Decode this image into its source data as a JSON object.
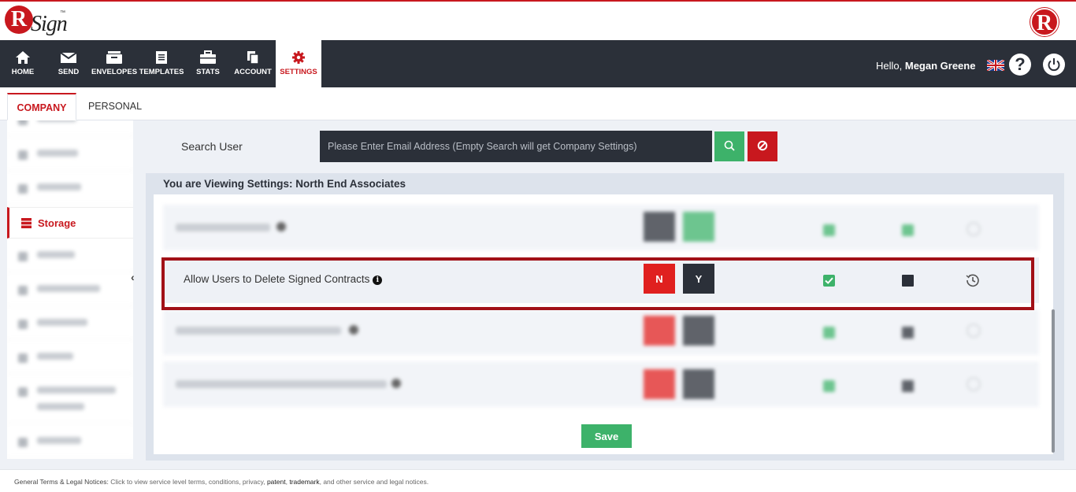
{
  "brand": {
    "logo_letter": "R",
    "logo_word": "Sign",
    "logo_tm": "™",
    "badge_letter": "R",
    "colors": {
      "accent": "#c8181e",
      "navbar": "#2b3039",
      "success": "#3db26a"
    }
  },
  "nav": {
    "items": [
      {
        "label": "HOME",
        "icon": "home-icon"
      },
      {
        "label": "SEND",
        "icon": "envelope-icon"
      },
      {
        "label": "ENVELOPES",
        "icon": "inbox-icon"
      },
      {
        "label": "TEMPLATES",
        "icon": "document-icon"
      },
      {
        "label": "STATS",
        "icon": "briefcase-icon"
      },
      {
        "label": "ACCOUNT",
        "icon": "copy-icon"
      },
      {
        "label": "SETTINGS",
        "icon": "gear-icon",
        "active": true
      }
    ],
    "greeting": "Hello,",
    "user_name": "Megan Greene",
    "help": "?"
  },
  "tabs": {
    "company": "COMPANY",
    "personal": "PERSONAL"
  },
  "sidebar": {
    "active_label": "Storage",
    "collapse_glyph": "‹"
  },
  "search": {
    "label": "Search User",
    "placeholder": "Please Enter Email Address (Empty Search will get Company Settings)"
  },
  "panel": {
    "title": "You are Viewing Settings: North End Associates",
    "focused_row": {
      "label": "Allow Users to Delete Signed Contracts",
      "info": "i",
      "no_label": "N",
      "yes_label": "Y"
    },
    "save_label": "Save"
  },
  "footer": {
    "heading": "General Terms & Legal Notices:",
    "text_1": "Click to view service level terms, conditions, privacy,",
    "patent": "patent",
    "comma": ",",
    "trademark": "trademark",
    "text_2": ", and other service and legal notices."
  }
}
